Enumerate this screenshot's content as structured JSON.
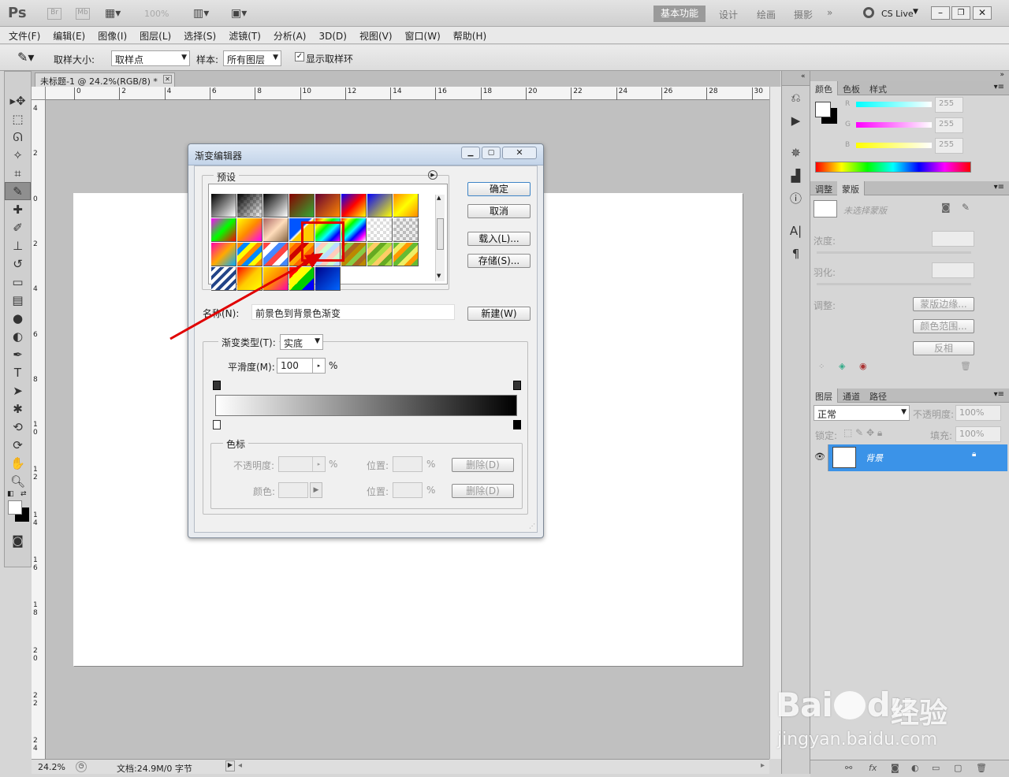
{
  "app": {
    "logo": "Ps",
    "bridge_btn": "Br",
    "minibridge_btn": "Mb",
    "zoom_value": "100%",
    "workspaces": [
      "基本功能",
      "设计",
      "绘画",
      "摄影"
    ],
    "cs_live": "CS Live"
  },
  "menu": [
    "文件(F)",
    "编辑(E)",
    "图像(I)",
    "图层(L)",
    "选择(S)",
    "滤镜(T)",
    "分析(A)",
    "3D(D)",
    "视图(V)",
    "窗口(W)",
    "帮助(H)"
  ],
  "options_bar": {
    "sample_size_label": "取样大小:",
    "sample_size_value": "取样点",
    "sample_label": "样本:",
    "sample_value": "所有图层",
    "show_ring_label": "显示取样环"
  },
  "document": {
    "tab_title": "未标题-1 @ 24.2%(RGB/8) *",
    "ruler_h": [
      "0",
      "2",
      "4",
      "6",
      "8",
      "10",
      "12",
      "14",
      "16",
      "18",
      "20",
      "22",
      "24",
      "26",
      "28",
      "30"
    ],
    "ruler_v": [
      "4",
      "2",
      "0",
      "2",
      "4",
      "6",
      "8",
      "10",
      "12",
      "14",
      "16",
      "18",
      "20",
      "22",
      "24"
    ],
    "zoom": "24.2%",
    "doc_info": "文档:24.9M/0 字节"
  },
  "dialog": {
    "title": "渐变编辑器",
    "presets_label": "预设",
    "ok": "确定",
    "cancel": "取消",
    "load": "载入(L)...",
    "save": "存储(S)...",
    "name_label": "名称(N):",
    "name_value": "前景色到背景色渐变",
    "new": "新建(W)",
    "type_label": "渐变类型(T):",
    "type_value": "实底",
    "smooth_label": "平滑度(M):",
    "smooth_value": "100",
    "percent": "%",
    "stops_label": "色标",
    "opacity_label": "不透明度:",
    "position_label": "位置:",
    "color_label": "颜色:",
    "delete_label": "删除(D)"
  },
  "color_panel": {
    "tabs": [
      "颜色",
      "色板",
      "样式"
    ],
    "channels": [
      {
        "name": "R",
        "value": "255"
      },
      {
        "name": "G",
        "value": "255"
      },
      {
        "name": "B",
        "value": "255"
      }
    ]
  },
  "masks_panel": {
    "tabs": [
      "调整",
      "蒙版"
    ],
    "no_mask": "未选择蒙版",
    "density": "浓度:",
    "feather": "羽化:",
    "refine_label": "调整:",
    "mask_edge": "蒙版边缘...",
    "color_range": "颜色范围...",
    "invert": "反相"
  },
  "layers_panel": {
    "tabs": [
      "图层",
      "通道",
      "路径"
    ],
    "blend_mode": "正常",
    "opacity_label": "不透明度:",
    "opacity_value": "100%",
    "lock_label": "锁定:",
    "fill_label": "填充:",
    "fill_value": "100%",
    "layer_name": "背景"
  },
  "watermark": {
    "brand": "Bai",
    "brand2": "du",
    "cn": "经验",
    "url": "jingyan.baidu.com"
  }
}
